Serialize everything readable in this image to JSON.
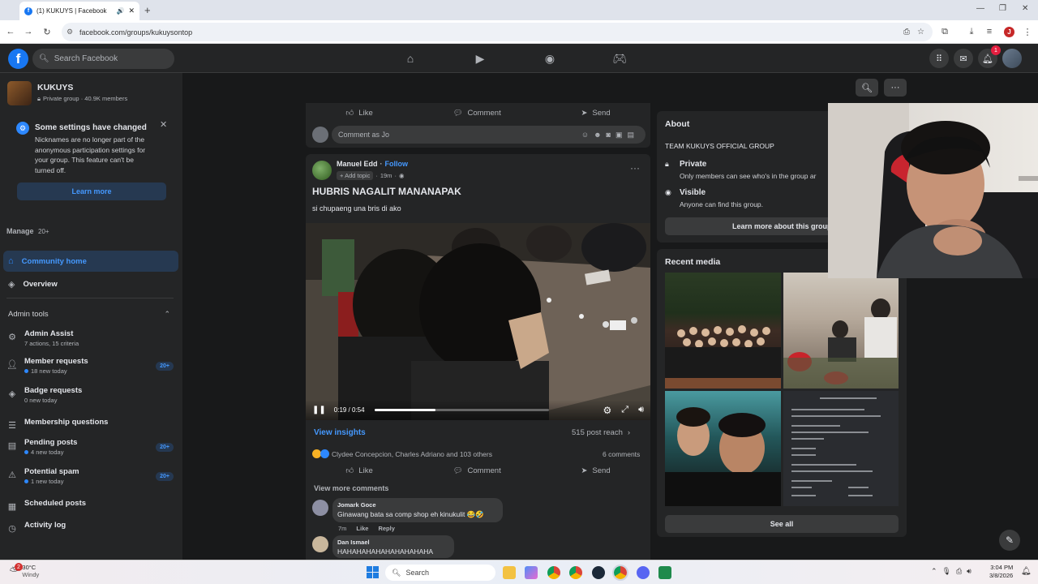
{
  "browser": {
    "tab_title": "(1) KUKUYS | Facebook",
    "url": "facebook.com/groups/kukuysontop"
  },
  "header": {
    "search_placeholder": "Search Facebook",
    "notif_count": "1",
    "brand_color": "#1877f2"
  },
  "group": {
    "name": "KUKUYS",
    "meta": "Private group · 40.9K members"
  },
  "notice": {
    "title": "Some settings have changed",
    "body": "Nicknames are no longer part of the anonymous participation settings for your group. This feature can't be turned off.",
    "button": "Learn more"
  },
  "sidebar": {
    "manage_label": "Manage",
    "manage_count": "20+",
    "community_home": "Community home",
    "overview": "Overview",
    "admin_tools": "Admin tools",
    "items": [
      {
        "label": "Admin Assist",
        "sub": "7 actions, 15 criteria",
        "icon": "gear-icon"
      },
      {
        "label": "Member requests",
        "sub": "18 new today",
        "badge": "20+",
        "icon": "person-add-icon"
      },
      {
        "label": "Badge requests",
        "sub": "0 new today",
        "icon": "badge-icon"
      },
      {
        "label": "Membership questions",
        "sub": "",
        "icon": "questions-icon"
      },
      {
        "label": "Pending posts",
        "sub": "4 new today",
        "badge": "20+",
        "icon": "pending-icon"
      },
      {
        "label": "Potential spam",
        "sub": "1 new today",
        "badge": "20+",
        "icon": "warning-icon"
      },
      {
        "label": "Scheduled posts",
        "sub": "",
        "icon": "calendar-icon"
      },
      {
        "label": "Activity log",
        "sub": "",
        "icon": "clock-icon"
      }
    ]
  },
  "top_actions": {
    "like": "Like",
    "comment": "Comment",
    "send": "Send",
    "comment_placeholder": "Comment as Jo"
  },
  "post": {
    "author": "Manuel Edd",
    "follow": "Follow",
    "add_topic": "Add topic",
    "time": "19m",
    "title": "HUBRIS NAGALIT MANANAPAK",
    "body": "si chupaeng una bris di ako",
    "video_time": "0:19 / 0:54",
    "video_progress": 0.35,
    "view_insights": "View insights",
    "reach": "515 post reach",
    "reactions": "Clydee Concepcion, Charles Adriano and 103 others",
    "comments_count": "6 comments",
    "like": "Like",
    "comment": "Comment",
    "send": "Send",
    "view_more": "View more comments",
    "comments": [
      {
        "name": "Jomark Goce",
        "text": "Ginawang bata sa comp shop eh kinukulit 😂🤣",
        "time": "7m",
        "like": "Like",
        "reply": "Reply"
      },
      {
        "name": "Dan Ismael",
        "text": "HAHAHAHAHAHAHAHAHAHA"
      }
    ]
  },
  "about": {
    "title": "About",
    "description": "TEAM KUKUYS OFFICIAL GROUP",
    "private_title": "Private",
    "private_desc": "Only members can see who's in the group ar",
    "visible_title": "Visible",
    "visible_desc": "Anyone can find this group.",
    "learn_more": "Learn more about this group"
  },
  "media": {
    "title": "Recent media",
    "see_all": "See all"
  },
  "taskbar": {
    "weather_temp": "30°C",
    "weather_desc": "Windy",
    "weather_badge": "2",
    "search": "Search",
    "time": "3:04 PM",
    "date": "3/8/2026"
  }
}
